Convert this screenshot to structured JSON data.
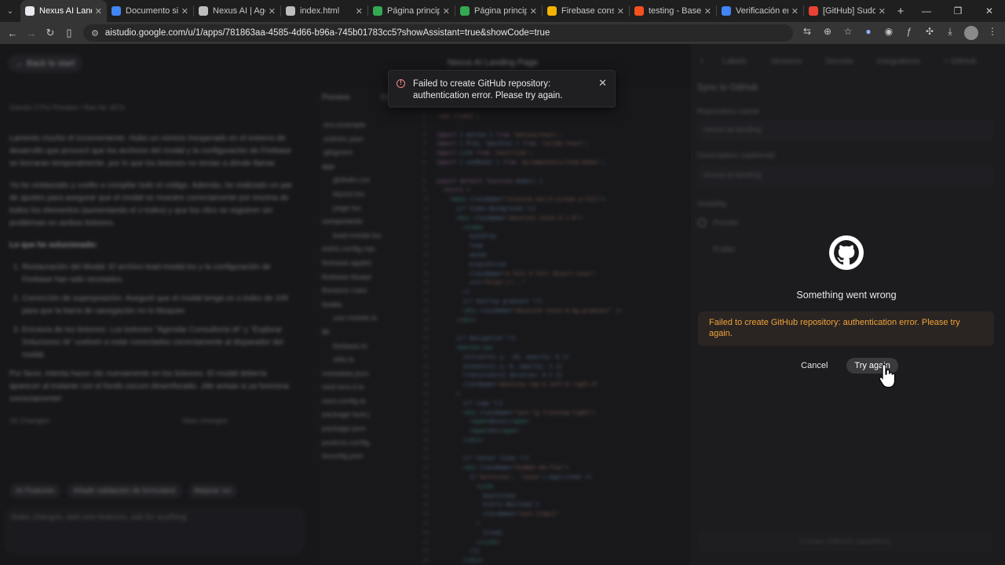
{
  "browser": {
    "tabs": [
      {
        "title": "Nexus AI Landing",
        "active": true,
        "favicon_color": "#e8eaed"
      },
      {
        "title": "Documento sin tít",
        "favicon_color": "#4285f4"
      },
      {
        "title": "Nexus AI | Agenc",
        "favicon_color": "#bdbdbd"
      },
      {
        "title": "index.html",
        "favicon_color": "#bdbdbd"
      },
      {
        "title": "Página principal -",
        "favicon_color": "#34a853"
      },
      {
        "title": "Página principal -",
        "favicon_color": "#34a853"
      },
      {
        "title": "Firebase console",
        "favicon_color": "#f4b400"
      },
      {
        "title": "testing - Base de",
        "favicon_color": "#f4511e"
      },
      {
        "title": "Verificación en 2",
        "favicon_color": "#4285f4"
      },
      {
        "title": "[GitHub] Sudo em",
        "favicon_color": "#ea4335"
      }
    ],
    "url": "aistudio.google.com/u/1/apps/781863aa-4585-4d66-b96a-745b01783cc5?showAssistant=true&showCode=true"
  },
  "app": {
    "back_label": "← Back to start",
    "title": "Nexus AI Landing Page",
    "chat": {
      "model_line": "Gemini 3 Pro Preview • Ran for 457s",
      "paragraphs": [
        "Lamento mucho el inconveniente. Hubo un reinicio inesperado en el entorno de desarrollo que provocó que los archivos del modal y la configuración de Firebase se borraran temporalmente, por lo que los botones no tenían a dónde llamar.",
        "Ya he restaurado y vuelto a compilar todo el código. Además, he realizado un par de ajustes para asegurar que el modal se muestre correctamente por encima de todos los elementos (aumentando el z-index) y que los clics se registren sin problemas en ambos botones.",
        "Lo que he solucionado:"
      ],
      "list": [
        "Restauración del Modal: El archivo lead-modal.tsx y la configuración de Firebase han sido recreados.",
        "Corrección de superposición: Aseguré que el modal tenga un z-index de 100 para que la barra de navegación no lo bloquee.",
        "Enrutura de los botones: Los botones \"Agendar Consultoría IA\" y \"Explorar Soluciones IA\" vuelven a estar conectados correctamente al disparador del modal."
      ],
      "closing": "Por favor, intenta hacer clic nuevamente en los botones. El modal debería aparecer al instante con el fondo oscuro desenfocado. ¡Me avisas si ya funciona correctamente!",
      "changes": "16 Changes",
      "view_changes": "View changes",
      "chips": [
        "AI Features",
        "Añadir validación de formulario",
        "Mejorar sci"
      ],
      "composer_placeholder": "Make changes, add new features, ask for anything"
    },
    "editor": {
      "tabs": [
        "Preview",
        "Code"
      ],
      "files": [
        ".env.example",
        ".eslintrc.json",
        ".gitignore",
        "app",
        "globals.css",
        "layout.tsx",
        "page.tsx",
        "components",
        "lead-modal.tsx",
        "eslint.config.mjs",
        "firebase-applet",
        "firebase-bluepr",
        "firestore.rules",
        "hooks",
        "use-mobile.ts",
        "lib",
        "firebase.ts",
        "utils.ts",
        "metadata.json",
        "next-env.d.ts",
        "next.config.ts",
        "package-lock.j",
        "package.json",
        "postcss.config.",
        "tsconfig.json"
      ]
    },
    "panel": {
      "tabs": [
        "Labels",
        "Versions",
        "Secrets",
        "Integrations",
        "+ GitHub"
      ],
      "heading": "Sync to GitHub",
      "repo_label": "Repository name",
      "repo_value": "nexus-ai-landing",
      "desc_label": "Description (optional)",
      "desc_value": "nexus-ai-landing",
      "visibility_label": "Visibility",
      "private_label": "Private",
      "public_label": "Public",
      "create_button": "Create GitHub repository",
      "error_title": "Something went wrong",
      "error_message": "Failed to create GitHub repository: authentication error. Please try again.",
      "cancel_label": "Cancel",
      "try_again_label": "Try again",
      "error_color": "#f2a33a"
    }
  },
  "toast": {
    "message": "Failed to create GitHub repository: authentication error. Please try again."
  }
}
